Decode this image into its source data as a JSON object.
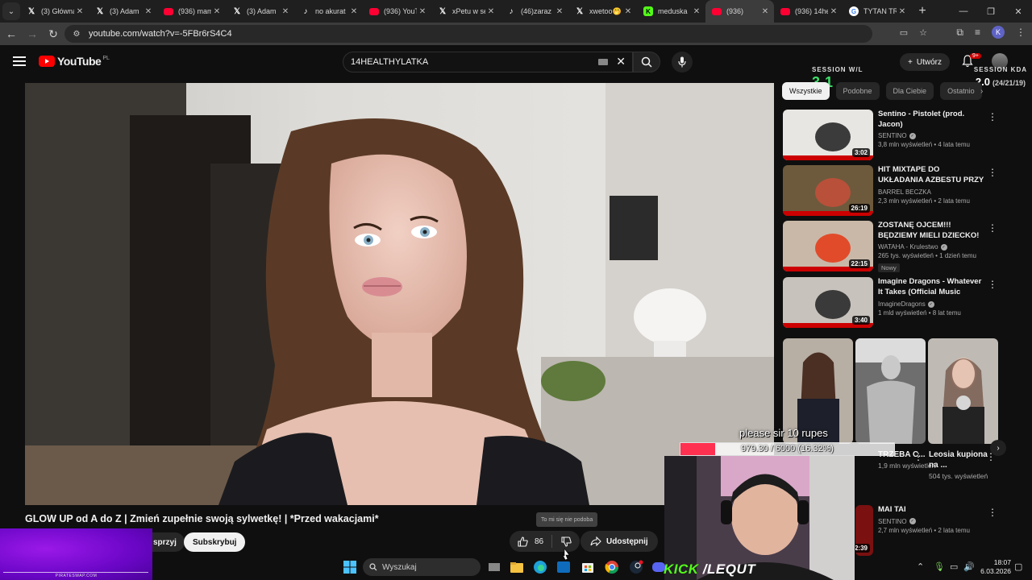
{
  "browser": {
    "tabs": [
      {
        "icon": "x-icon",
        "title": "(3) Główna / X",
        "active": false
      },
      {
        "icon": "x-icon",
        "title": "(3) Adam",
        "active": false
      },
      {
        "icon": "youtube-icon",
        "title": "(936) mam",
        "active": false
      },
      {
        "icon": "x-icon",
        "title": "(3) Adam",
        "active": false
      },
      {
        "icon": "tiktok-icon",
        "title": "no akurat",
        "active": false
      },
      {
        "icon": "youtube-icon",
        "title": "(936) YouT",
        "active": false
      },
      {
        "icon": "x-icon",
        "title": "xPetu w se",
        "active": false
      },
      {
        "icon": "tiktok-icon",
        "title": "(46)zaraz",
        "active": false
      },
      {
        "icon": "x-icon",
        "title": "xwetoo🤭",
        "active": false
      },
      {
        "icon": "kick-icon",
        "title": "meduska",
        "active": false
      },
      {
        "icon": "youtube-icon",
        "title": "(936)",
        "active": true
      },
      {
        "icon": "youtube-icon",
        "title": "(936) 14he",
        "active": false
      },
      {
        "icon": "google-icon",
        "title": "TYTAN TR",
        "active": false
      }
    ],
    "url": "youtube.com/watch?v=-5FBr6rS4C4"
  },
  "youtube": {
    "logo_text": "YouTube",
    "country_code": "PL",
    "search_value": "14HEALTHYLATKA",
    "create_label": "Utwórz",
    "notification_count": "9+",
    "video_title": "GLOW UP od A do Z | Zmień zupełnie swoją sylwetkę! | *Przed wakacjami*",
    "join_label": "sprzyj",
    "subscribe_label": "Subskrybuj",
    "like_count": "86",
    "share_label": "Udostępnij",
    "dislike_tooltip": "To mi się nie podoba",
    "chips": [
      "Wszystkie",
      "Podobne",
      "Dla Ciebie",
      "Ostatnio"
    ],
    "recommendations": [
      {
        "title": "Sentino - Pistolet (prod. Jacon)",
        "channel": "SENTINO",
        "verified": true,
        "meta": "3,8 mln wyświetleń • 4 lata temu",
        "duration": "3:02",
        "badge": ""
      },
      {
        "title": "HIT MIXTAPE DO UKŁADANIA AZBESTU PRZY ...",
        "channel": "BARREL BECZKA",
        "verified": false,
        "meta": "2,3 mln wyświetleń • 2 lata temu",
        "duration": "26:19",
        "badge": ""
      },
      {
        "title": "ZOSTANĘ OJCEM!!! BĘDZIEMY MIELI DZIECKO!",
        "channel": "WATAHA - Krulestwo",
        "verified": true,
        "meta": "265 tys. wyświetleń • 1 dzień temu",
        "duration": "22:15",
        "badge": "Nowy"
      },
      {
        "title": "Imagine Dragons - Whatever It Takes (Official Music Video)",
        "channel": "ImagineDragons",
        "verified": true,
        "meta": "1 mld wyświetleń • 8 lat temu",
        "duration": "3:40",
        "badge": ""
      }
    ],
    "shorts": [
      {
        "title": "TRZEBA C...",
        "views": "1,9 mln wyświetleń"
      },
      {
        "title": "Leosia kupiona na ...",
        "views": "504 tys. wyświetleń"
      }
    ],
    "last_rec": {
      "title": "MAI TAI",
      "channel": "SENTINO",
      "meta": "2,7 mln wyświetleń • 2 lata temu",
      "duration": "2:39"
    }
  },
  "overlay": {
    "session_wl_label": "SESSION W/L",
    "session_wl": "3-1",
    "session_kda_label": "SESSION KDA",
    "session_kda": "2.0",
    "session_kda_detail": "(24/21/19)",
    "donation_message": "please sir 10 rupes",
    "goal_text": "979.30 / 6000 (16.32%)",
    "goal_fraction": 0.1632,
    "kick_text": "KICK",
    "kick_user": "LEQUT",
    "pirateswap": "PIRATESWAP.COM"
  },
  "taskbar": {
    "search_placeholder": "Wyszukaj",
    "time": "18:07",
    "date": "6.03.2026"
  },
  "colors": {
    "youtube_red": "#ff0000",
    "kick_green": "#53fc18",
    "session_green": "#3ee06a",
    "goal_red": "#ff3050"
  }
}
